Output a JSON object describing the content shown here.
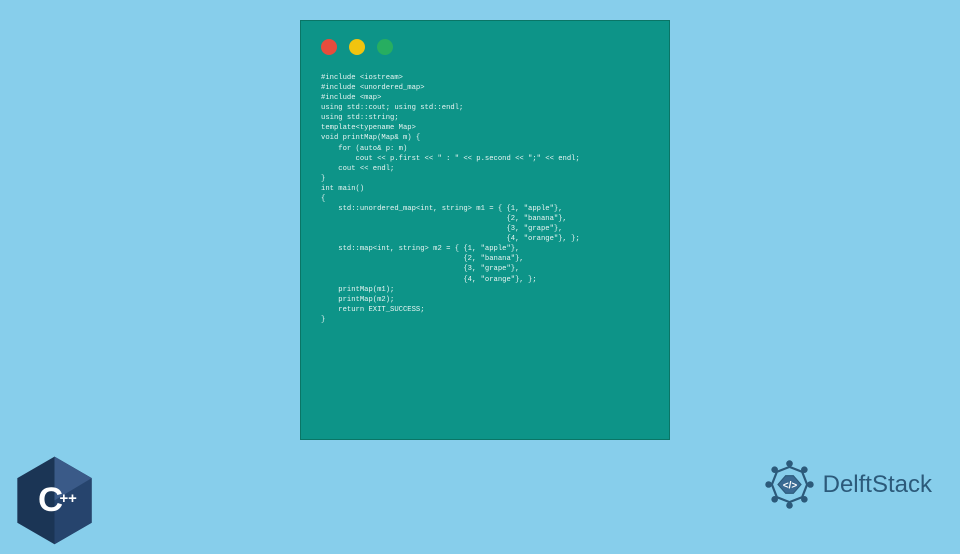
{
  "colors": {
    "background": "#87ceeb",
    "terminal": "#0d9488",
    "dotRed": "#e74c3c",
    "dotYellow": "#f1c40f",
    "dotGreen": "#27ae60",
    "codeText": "#e8f5f2",
    "logoBlue": "#2c5a7a"
  },
  "code": {
    "lines": [
      "#include <iostream>",
      "#include <unordered_map>",
      "#include <map>",
      "",
      "using std::cout; using std::endl;",
      "using std::string;",
      "",
      "template<typename Map>",
      "void printMap(Map& m) {",
      "    for (auto& p: m)",
      "        cout << p.first << \" : \" << p.second << \";\" << endl;",
      "    cout << endl;",
      "}",
      "",
      "int main()",
      "{",
      "    std::unordered_map<int, string> m1 = { {1, \"apple\"},",
      "                                           {2, \"banana\"},",
      "                                           {3, \"grape\"},",
      "                                           {4, \"orange\"}, };",
      "",
      "    std::map<int, string> m2 = { {1, \"apple\"},",
      "                                 {2, \"banana\"},",
      "                                 {3, \"grape\"},",
      "                                 {4, \"orange\"}, };",
      "",
      "    printMap(m1);",
      "    printMap(m2);",
      "",
      "    return EXIT_SUCCESS;",
      "}"
    ]
  },
  "logos": {
    "cpp": "C++",
    "brand": "DelftStack"
  }
}
